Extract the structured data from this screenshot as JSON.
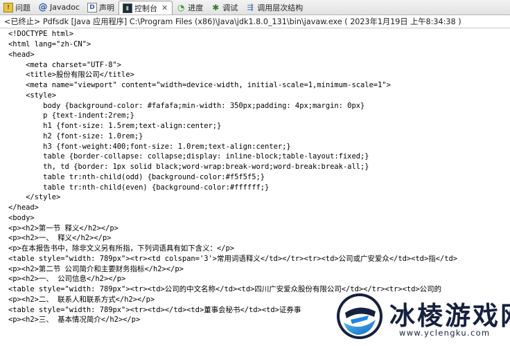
{
  "tabs": [
    {
      "label": "问题",
      "icon": "problems-icon",
      "active": false
    },
    {
      "label": "Javadoc",
      "icon": "javadoc-icon",
      "active": false
    },
    {
      "label": "声明",
      "icon": "declaration-icon",
      "active": false
    },
    {
      "label": "控制台",
      "icon": "console-icon",
      "active": true,
      "close": "✕"
    },
    {
      "label": "进度",
      "icon": "progress-icon",
      "active": false
    },
    {
      "label": "调试",
      "icon": "debug-icon",
      "active": false
    },
    {
      "label": "调用层次结构",
      "icon": "call-hierarchy-icon",
      "active": false
    }
  ],
  "launch_info": "<已终止> Pdfsdk [Java 应用程序] C:\\Program Files (x86)\\Java\\jdk1.8.0_131\\bin\\javaw.exe ( 2023年1月19日 上午8:34:38 )",
  "console_lines": [
    "<!DOCTYPE html>",
    "<html lang=\"zh-CN\">",
    "<head>",
    "    <meta charset=\"UTF-8\">",
    "    <title>股份有限公司</title>",
    "    <meta name=\"viewport\" content=\"width=device-width, initial-scale=1,minimum-scale=1\">",
    "    <style>",
    "        body {background-color: #fafafa;min-width: 350px;padding: 4px;margin: 0px}",
    "        p {text-indent:2rem;}",
    "        h1 {font-size: 1.5rem;text-align:center;}",
    "        h2 {font-size: 1.0rem;}",
    "        h3 {font-weight:400;font-size: 1.0rem;text-align:center;}",
    "        table {border-collapse: collapse;display: inline-block;table-layout:fixed;}",
    "        th, td {border: 1px solid black;word-wrap:break-word;word-break:break-all;}",
    "        table tr:nth-child(odd) {background-color:#f5f5f5;}",
    "        table tr:nth-child(even) {background-color:#ffffff;}",
    "    </style>",
    "</head>",
    "<body>",
    "<p><h2>第一节 释义</h2></p>",
    "<p><h2>一、 释义</h2></p>",
    "<p>在本报告书中，除非文义另有所指，下列词语具有如下含义：</p>",
    "<table style=\"width: 789px\"><tr><td colspan='3'>常用词语释义</td></tr><tr><td>公司或广安爱众</td><td>指</td>",
    "<p><h2>第二节 公司简介和主要财务指标</h2></p>",
    "<p><h2>一、 公司信息</h2></p>",
    "<table style=\"width: 789px\"><tr><td>公司的中文名称</td><td>四川广安爱众股份有限公司</td></tr><tr><td>公司的",
    "<p><h2>二、 联系人和联系方式</h2></p>",
    "<table style=\"width: 789px\"><tr><td></td><td>董事会秘书</td><td>证券事",
    "<p><h2>三、 基本情况简介</h2></p>"
  ],
  "watermark": {
    "title": "冰棱游戏网",
    "url": "www.yclengku.com",
    "colors": {
      "dark": "#16213f",
      "accent": "#1e88e5",
      "light": "#4fc3f7"
    }
  }
}
